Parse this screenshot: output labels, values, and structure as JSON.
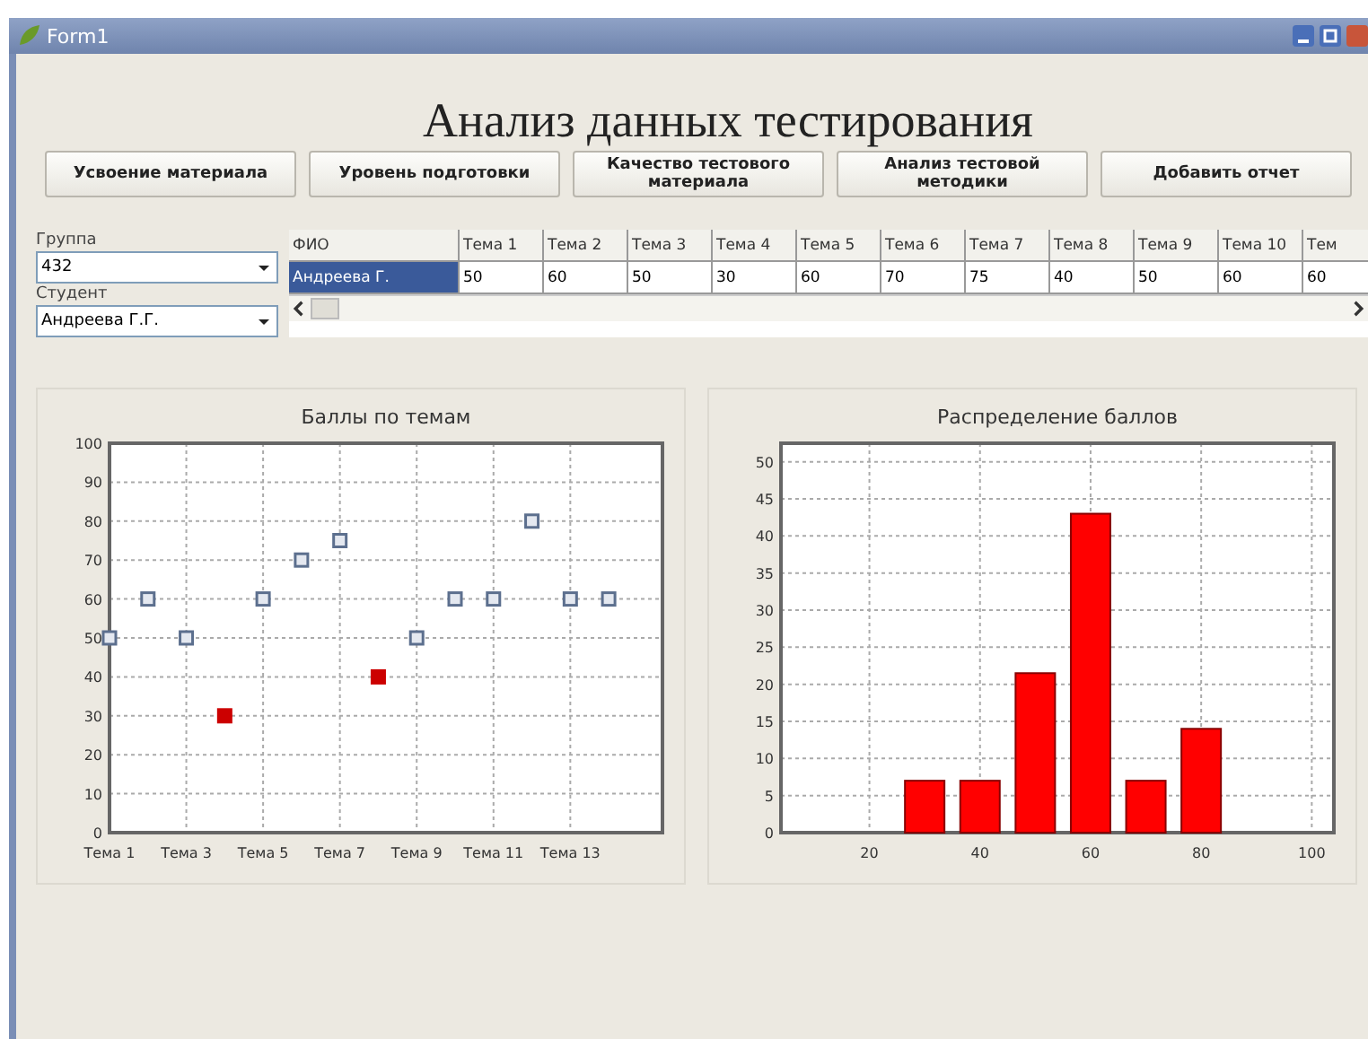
{
  "window": {
    "title": "Form1"
  },
  "heading": "Анализ данных тестирования",
  "buttons": [
    "Усвоение материала",
    "Уровень подготовки",
    "Качество тестового материала",
    "Анализ тестовой методики",
    "Добавить отчет"
  ],
  "filters": [
    {
      "label": "Группа",
      "value": "432"
    },
    {
      "label": "Студент",
      "value": "Андреева Г.Г."
    }
  ],
  "table": {
    "columns": [
      "ФИО",
      "Тема 1",
      "Тема 2",
      "Тема 3",
      "Тема 4",
      "Тема 5",
      "Тема 6",
      "Тема 7",
      "Тема 8",
      "Тема 9",
      "Тема 10",
      "Тем"
    ],
    "rows": [
      {
        "selected": true,
        "cells": [
          "Андреева Г.",
          "50",
          "60",
          "50",
          "30",
          "60",
          "70",
          "75",
          "40",
          "50",
          "60",
          "60"
        ]
      }
    ]
  },
  "charts": [
    {
      "chart_data": {
        "type": "scatter",
        "title": "Баллы по темам",
        "grid": true,
        "categories": [
          "Тема 1",
          null,
          "Тема 3",
          null,
          "Тема 5",
          null,
          "Тема 7",
          null,
          "Тема 9",
          null,
          "Тема 11",
          null,
          "Тема 13",
          null
        ],
        "ylim": [
          0,
          100
        ],
        "yticks": [
          0,
          10,
          20,
          30,
          40,
          50,
          60,
          70,
          80,
          90,
          100
        ],
        "series": [
          {
            "color": "#5c6f8e",
            "values": [
              50,
              60,
              50,
              null,
              60,
              70,
              75,
              null,
              50,
              60,
              60,
              80,
              60,
              60
            ]
          },
          {
            "color": "#cc0000",
            "values": [
              null,
              null,
              null,
              30,
              null,
              null,
              null,
              40,
              null,
              null,
              null,
              null,
              null,
              null
            ]
          }
        ]
      }
    },
    {
      "chart_data": {
        "type": "bar",
        "title": "Распределение баллов",
        "grid": true,
        "x": [
          30,
          40,
          50,
          60,
          70,
          80
        ],
        "xlim": [
          4,
          104
        ],
        "ylim": [
          0,
          52.5
        ],
        "xticks": [
          20,
          40,
          60,
          80,
          100
        ],
        "yticks": [
          0,
          5,
          10,
          15,
          20,
          25,
          30,
          35,
          40,
          45,
          50
        ],
        "series": [
          {
            "color": "#ff0000",
            "values": [
              7,
              7,
              21.5,
              43,
              7,
              14
            ]
          }
        ]
      }
    }
  ]
}
